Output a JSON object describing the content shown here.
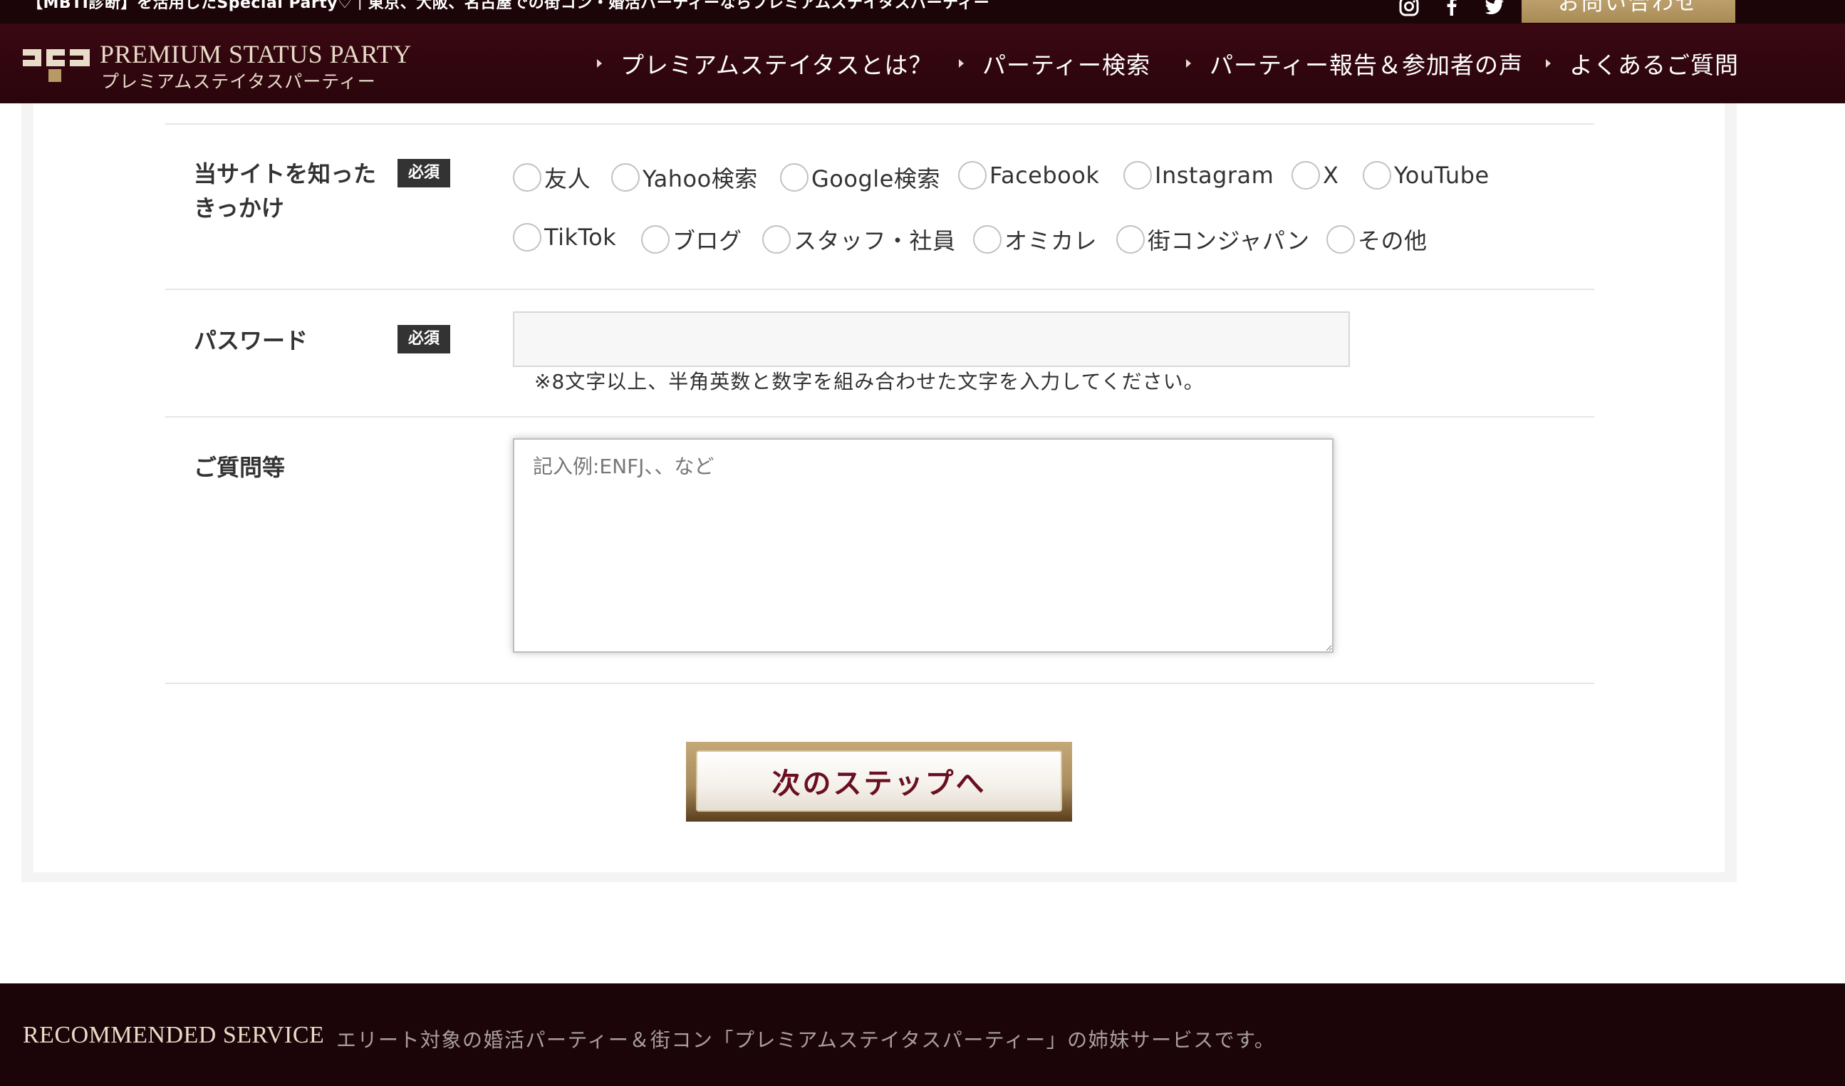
{
  "topbar": {
    "text": "【MBTI診断】を活用したSpecial Party♡｜東京、大阪、名古屋での街コン・婚活パーティーならプレミアムステイタスパーティー",
    "social_icons": [
      "instagram-icon",
      "facebook-icon",
      "twitter-icon"
    ],
    "contact_label": "お問い合わせ"
  },
  "header": {
    "logo_en": "PREMIUM STATUS PARTY",
    "logo_ja": "プレミアムステイタスパーティー",
    "nav": [
      {
        "label": "プレミアムステイタスとは？"
      },
      {
        "label": "パーティー検索"
      },
      {
        "label": "パーティー報告＆参加者の声"
      },
      {
        "label": "よくあるご質問"
      }
    ]
  },
  "form": {
    "required_label": "必須",
    "referral": {
      "label_line1": "当サイトを知った",
      "label_line2": "きっかけ",
      "options": [
        "友人",
        "Yahoo検索",
        "Google検索",
        "Facebook",
        "Instagram",
        "X",
        "YouTube",
        "TikTok",
        "ブログ",
        "スタッフ・社員",
        "オミカレ",
        "街コンジャパン",
        "その他"
      ]
    },
    "password": {
      "label": "パスワード",
      "value": "",
      "note": "※8文字以上、半角英数と数字を組み合わせた文字を入力してください。"
    },
    "questions": {
      "label": "ご質問等",
      "placeholder": "記入例:ENFJ、、など"
    },
    "next_label": "次のステップへ"
  },
  "footer": {
    "title": "RECOMMENDED SERVICE",
    "description": "エリート対象の婚活パーティー＆街コン「プレミアムステイタスパーティー」の姉妹サービスです。"
  },
  "colors": {
    "header_bg": "#2a050c",
    "topbar_bg": "#1c0508",
    "gold": "#b89a66",
    "button_text": "#6a0f22",
    "required_badge": "#333333"
  }
}
